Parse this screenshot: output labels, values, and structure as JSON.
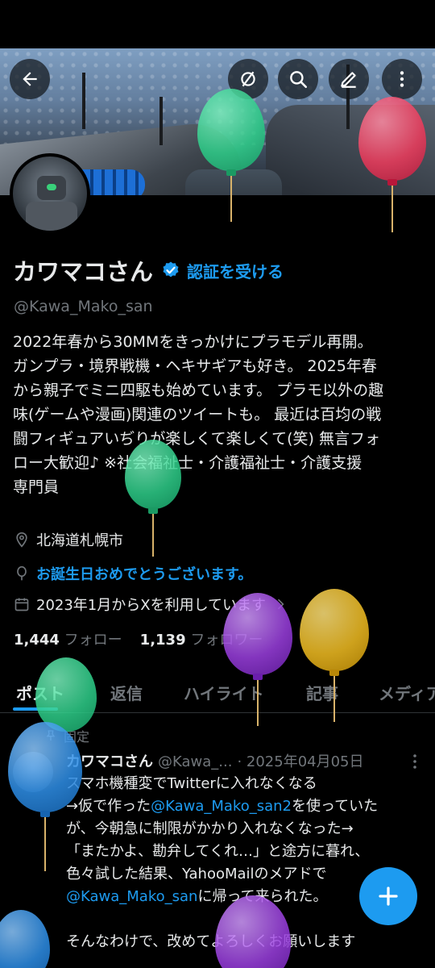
{
  "header": {
    "back_icon": "arrow-left-icon",
    "icons": [
      "ring-slash-icon",
      "search-icon",
      "pencil-icon",
      "more-vertical-icon"
    ]
  },
  "profile": {
    "display_name": "カワマコさん",
    "verify_label": "認証を受ける",
    "handle": "@Kawa_Mako_san",
    "bio": "2022年春から30MMをきっかけにプラモデル再開。\nガンプラ・境界戦機・ヘキサギアも好き。 2025年春\nから親子でミニ四駆も始めています。 プラモ以外の趣\n味(ゲームや漫画)関連のツイートも。 最近は百均の戦\n闘フィギュアいぢりが楽しくて楽しくて(笑) 無言フォ\nロー大歓迎♪ ※社会福祉士・介護福祉士・介護支援\n専門員",
    "location": "北海道札幌市",
    "birthday": "お誕生日おめでとうございます。",
    "joined": "2023年1月からXを利用しています",
    "following_count": "1,444",
    "following_label": "フォロー",
    "followers_count": "1,139",
    "followers_label": "フォロワー"
  },
  "tabs": [
    "ポスト",
    "返信",
    "ハイライト",
    "記事",
    "メディア"
  ],
  "post": {
    "pinned_label": "固定",
    "author_name": "カワマコさん",
    "author_handle": "@Kawa_...",
    "date": "· 2025年04月05日",
    "text_1": "スマホ機種変でTwitterに入れなくなる\n→仮で作った",
    "link_1": "@Kawa_Mako_san2",
    "text_2": "を使っていた\nが、今朝急に制限がかかり入れなくなった→\n「またかよ、勘弁してくれ…」と途方に暮れ、\n色々試した結果、YahooMailのメアドで\n",
    "link_2": "@Kawa_Mako_san",
    "text_3": "に帰って来られた。\n\nそんなわけで、改めてよろしくお願いします"
  },
  "colors": {
    "accent": "#1d9bf0",
    "background": "#000000",
    "muted": "#71767b",
    "balloon_green": "#2ecf8a",
    "balloon_red": "#ef3b5c",
    "balloon_purple": "#9b3fe0",
    "balloon_yellow": "#f2be22",
    "balloon_blue": "#2e8fe8"
  }
}
